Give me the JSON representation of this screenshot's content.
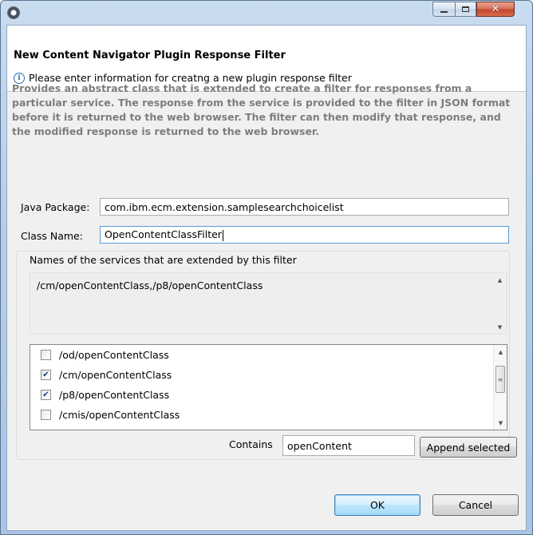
{
  "window": {
    "title": ""
  },
  "header": {
    "title": "New Content Navigator Plugin Response Filter",
    "message": "Please enter information for creatng a new plugin response filter"
  },
  "description": "Provides an abstract class that is extended to create a filter for responses from a particular service. The response from the service is provided to the filter in JSON format before it is returned to the web browser. The filter can then modify that response, and the modified response is returned to the web browser.",
  "form": {
    "java_package_label": "Java Package:",
    "java_package_value": "com.ibm.ecm.extension.samplesearchchoicelist",
    "class_name_label": "Class Name:",
    "class_name_value": "OpenContentClassFilter"
  },
  "services": {
    "label": "Names of the services that are extended by this filter",
    "value": "/cm/openContentClass,/p8/openContentClass",
    "list": [
      {
        "label": "/od/openContentClass",
        "checked": false
      },
      {
        "label": "/cm/openContentClass",
        "checked": true
      },
      {
        "label": "/p8/openContentClass",
        "checked": true
      },
      {
        "label": "/cmis/openContentClass",
        "checked": false
      }
    ],
    "contains_label": "Contains",
    "contains_value": "openContent",
    "append_label": "Append selected"
  },
  "footer": {
    "ok_label": "OK",
    "cancel_label": "Cancel"
  },
  "icons": {
    "app": "app-icon",
    "info": "info-icon",
    "check": "checkmark-icon"
  },
  "colors": {
    "description_text": "#7d7d7d",
    "default_button_border": "#3c7fb1"
  }
}
